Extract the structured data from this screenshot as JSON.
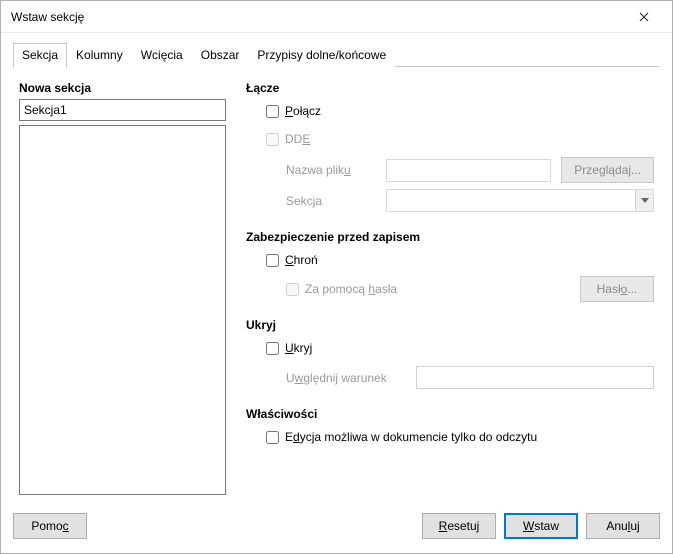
{
  "window": {
    "title": "Wstaw sekcję"
  },
  "tabs": {
    "section": "Sekcja",
    "columns": "Kolumny",
    "indents": "Wcięcia",
    "area": "Obszar",
    "footnotes": "Przypisy dolne/końcowe"
  },
  "left": {
    "heading": "Nowa sekcja",
    "name_value": "Sekcja1"
  },
  "link": {
    "heading": "Łącze",
    "connect_label": "Połącz",
    "dde_label": "DDE",
    "filename_label": "Nazwa pliku",
    "browse_btn": "Przeglądaj...",
    "section_label": "Sekcja"
  },
  "protect": {
    "heading": "Zabezpieczenie przed zapisem",
    "protect_label": "Chroń",
    "with_pwd_label": "Za pomocą hasła",
    "pwd_btn": "Hasło..."
  },
  "hide": {
    "heading": "Ukryj",
    "hide_label": "Ukryj",
    "condition_label": "Uwzględnij warunek"
  },
  "props": {
    "heading": "Właściwości",
    "editable_label": "Edycja możliwa w dokumencie tylko do odczytu"
  },
  "footer": {
    "help": "Pomoc",
    "reset": "Resetuj",
    "insert": "Wstaw",
    "cancel": "Anuluj"
  }
}
